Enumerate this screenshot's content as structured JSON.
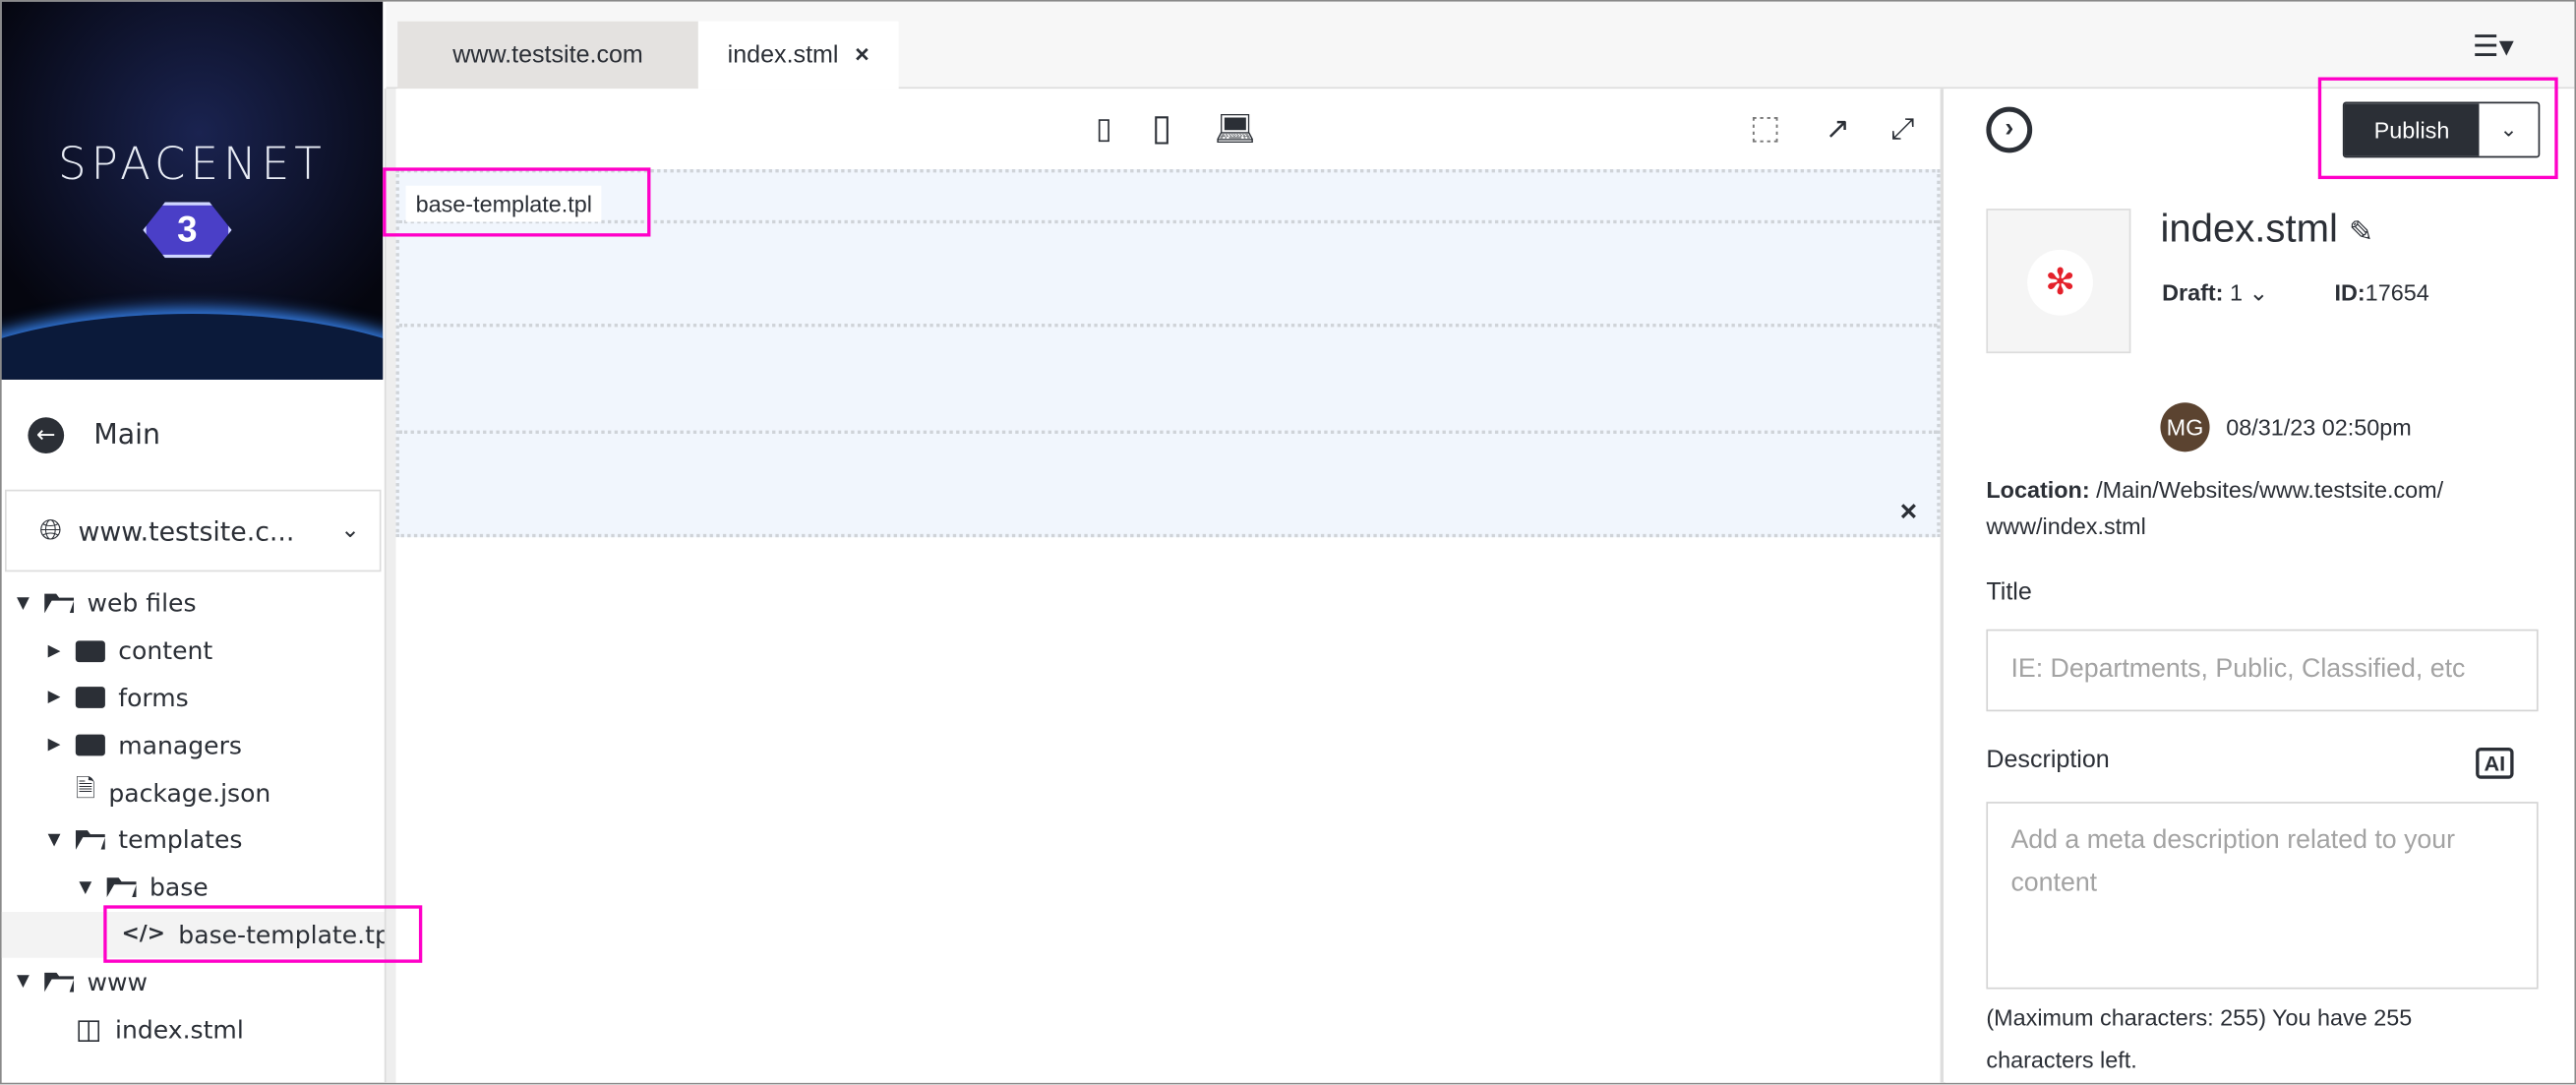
{
  "logo": {
    "text": "SPACENET",
    "badge": "3"
  },
  "sidebar": {
    "main_label": "Main",
    "site_selector": "www.testsite.c...",
    "tree": [
      {
        "label": "web files",
        "depth": 0,
        "type": "folder-open",
        "expanded": true
      },
      {
        "label": "content",
        "depth": 1,
        "type": "folder",
        "expanded": false
      },
      {
        "label": "forms",
        "depth": 1,
        "type": "folder",
        "expanded": false
      },
      {
        "label": "managers",
        "depth": 1,
        "type": "folder",
        "expanded": false
      },
      {
        "label": "package.json",
        "depth": 1,
        "type": "file-code"
      },
      {
        "label": "templates",
        "depth": 1,
        "type": "folder-open",
        "expanded": true
      },
      {
        "label": "base",
        "depth": 2,
        "type": "folder-open",
        "expanded": true
      },
      {
        "label": "base-template.tp",
        "depth": 3,
        "type": "code",
        "selected": true
      },
      {
        "label": "www",
        "depth": 0,
        "type": "folder-open",
        "expanded": true
      },
      {
        "label": "index.stml",
        "depth": 1,
        "type": "layout"
      }
    ]
  },
  "tabs": [
    {
      "label": "www.testsite.com",
      "active": false
    },
    {
      "label": "index.stml",
      "active": true,
      "close": "×"
    }
  ],
  "editor": {
    "template_label": "base-template.tpl",
    "close": "×"
  },
  "panel": {
    "publish_label": "Publish",
    "file_name": "index.stml",
    "draft_label": "Draft:",
    "draft_value": "1",
    "id_label": "ID:",
    "id_value": "17654",
    "avatar": "MG",
    "avatar_color": "#5b4330",
    "timestamp": "08/31/23 02:50pm",
    "location_label": "Location:",
    "location_value": "/Main/Websites/www.testsite.com/ www/index.stml",
    "title_label": "Title",
    "title_placeholder": "IE: Departments, Public, Classified, etc",
    "description_label": "Description",
    "ai_label": "AI",
    "description_placeholder": "Add a meta description related to your content",
    "char_note": "(Maximum characters: 255) You have 255 characters left."
  },
  "colors": {
    "highlight": "#ff00c8",
    "publish_bg": "#2b2f36",
    "canvas_bg": "#f1f6fd"
  }
}
